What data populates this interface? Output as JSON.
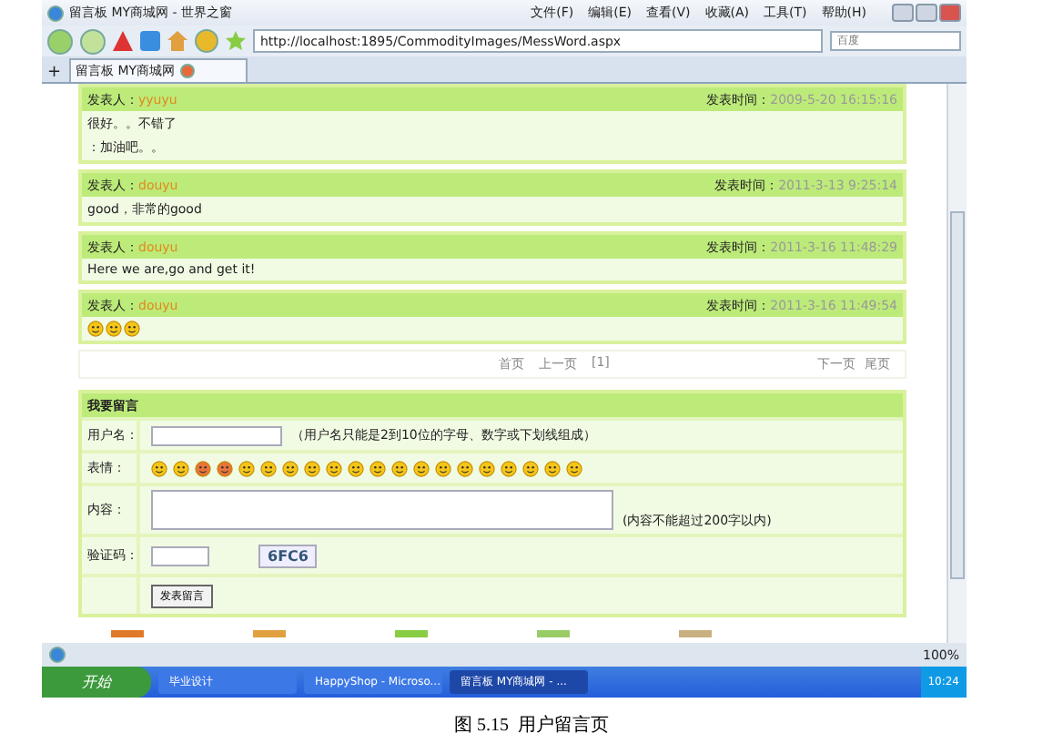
{
  "window": {
    "title": "留言板 MY商城网 - 世界之窗",
    "menu": [
      "文件(F)",
      "编辑(E)",
      "查看(V)",
      "收藏(A)",
      "工具(T)",
      "帮助(H)"
    ]
  },
  "address_bar": {
    "url": "http://localhost:1895/CommodityImages/MessWord.aspx"
  },
  "search": {
    "placeholder": "百度"
  },
  "new_tab": "+",
  "tabs": [
    {
      "label": "留言板 MY商城网",
      "selected": true
    }
  ],
  "messages": [
    {
      "author_label": "发表人：",
      "author": "yyuyu",
      "time_label": "发表时间：",
      "time": "2009-5-20 16:15:16",
      "content": [
        {
          "kind": "text",
          "text": "很好。。不错了"
        },
        {
          "kind": "text",
          "text": "：加油吧。。"
        }
      ]
    },
    {
      "author_label": "发表人：",
      "author": "douyu",
      "time_label": "发表时间：",
      "time": "2011-3-13 9:25:14",
      "content": [
        {
          "kind": "text",
          "text": "good，非常的good"
        }
      ]
    },
    {
      "author_label": "发表人：",
      "author": "douyu",
      "time_label": "发表时间：",
      "time": "2011-3-16 11:48:29",
      "content": [
        {
          "kind": "text",
          "text": "Here we are,go and get it!"
        }
      ]
    },
    {
      "author_label": "发表人：",
      "author": "douyu",
      "time_label": "发表时间：",
      "time": "2011-3-16 11:49:54",
      "content": [
        {
          "kind": "emoticon"
        },
        {
          "kind": "emoticon"
        },
        {
          "kind": "emoticon"
        }
      ]
    }
  ],
  "pager": {
    "left": [
      "首页",
      "上一页",
      "[1]"
    ],
    "right": [
      "下一页",
      "尾页"
    ]
  },
  "form": {
    "title": "我要留言",
    "username_label": "用户名：",
    "username_hint": "（用户名只能是2到10位的字母、数字或下划线组成）",
    "emoticon_label": "表情：",
    "emoticons": [
      {
        "kind": "smile"
      },
      {
        "kind": "smile"
      },
      {
        "kind": "red"
      },
      {
        "kind": "red"
      },
      {
        "kind": "smile"
      },
      {
        "kind": "smile"
      },
      {
        "kind": "smile"
      },
      {
        "kind": "smile"
      },
      {
        "kind": "smile"
      },
      {
        "kind": "smile"
      },
      {
        "kind": "smile"
      },
      {
        "kind": "smile"
      },
      {
        "kind": "smile"
      },
      {
        "kind": "smile"
      },
      {
        "kind": "smile"
      },
      {
        "kind": "smile"
      },
      {
        "kind": "smile"
      },
      {
        "kind": "smile"
      },
      {
        "kind": "smile"
      },
      {
        "kind": "smile"
      }
    ],
    "content_label": "内容：",
    "content_hint": "(内容不能超过200字以内)",
    "captcha_label": "验证码：",
    "captcha": "6FC6",
    "submit": "发表留言"
  },
  "status_bar": {
    "zoom": "100%"
  },
  "taskbar": {
    "start": "开始",
    "tasks": [
      {
        "label": "毕业设计",
        "selected": false
      },
      {
        "label": "HappyShop - Microso...",
        "selected": false
      },
      {
        "label": "留言板 MY商城网 - ...",
        "selected": true
      }
    ],
    "clock": "10:24"
  },
  "caption": "图 5.15  用户留言页"
}
